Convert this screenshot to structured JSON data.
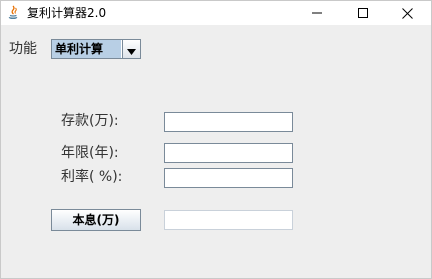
{
  "window": {
    "title": "复利计算器2.0"
  },
  "function_row": {
    "label": "功能",
    "selected": "单利计算"
  },
  "form": {
    "deposit_label": "存款(万):",
    "deposit_value": "",
    "years_label": "年限(年):",
    "years_value": "",
    "rate_label": "利率( %):",
    "rate_value": "",
    "result_button": "本息(万)",
    "result_value": ""
  },
  "colors": {
    "window_bg": "#eeeeee",
    "selection_bg": "#b8cfe5",
    "border": "#7a8a99"
  }
}
